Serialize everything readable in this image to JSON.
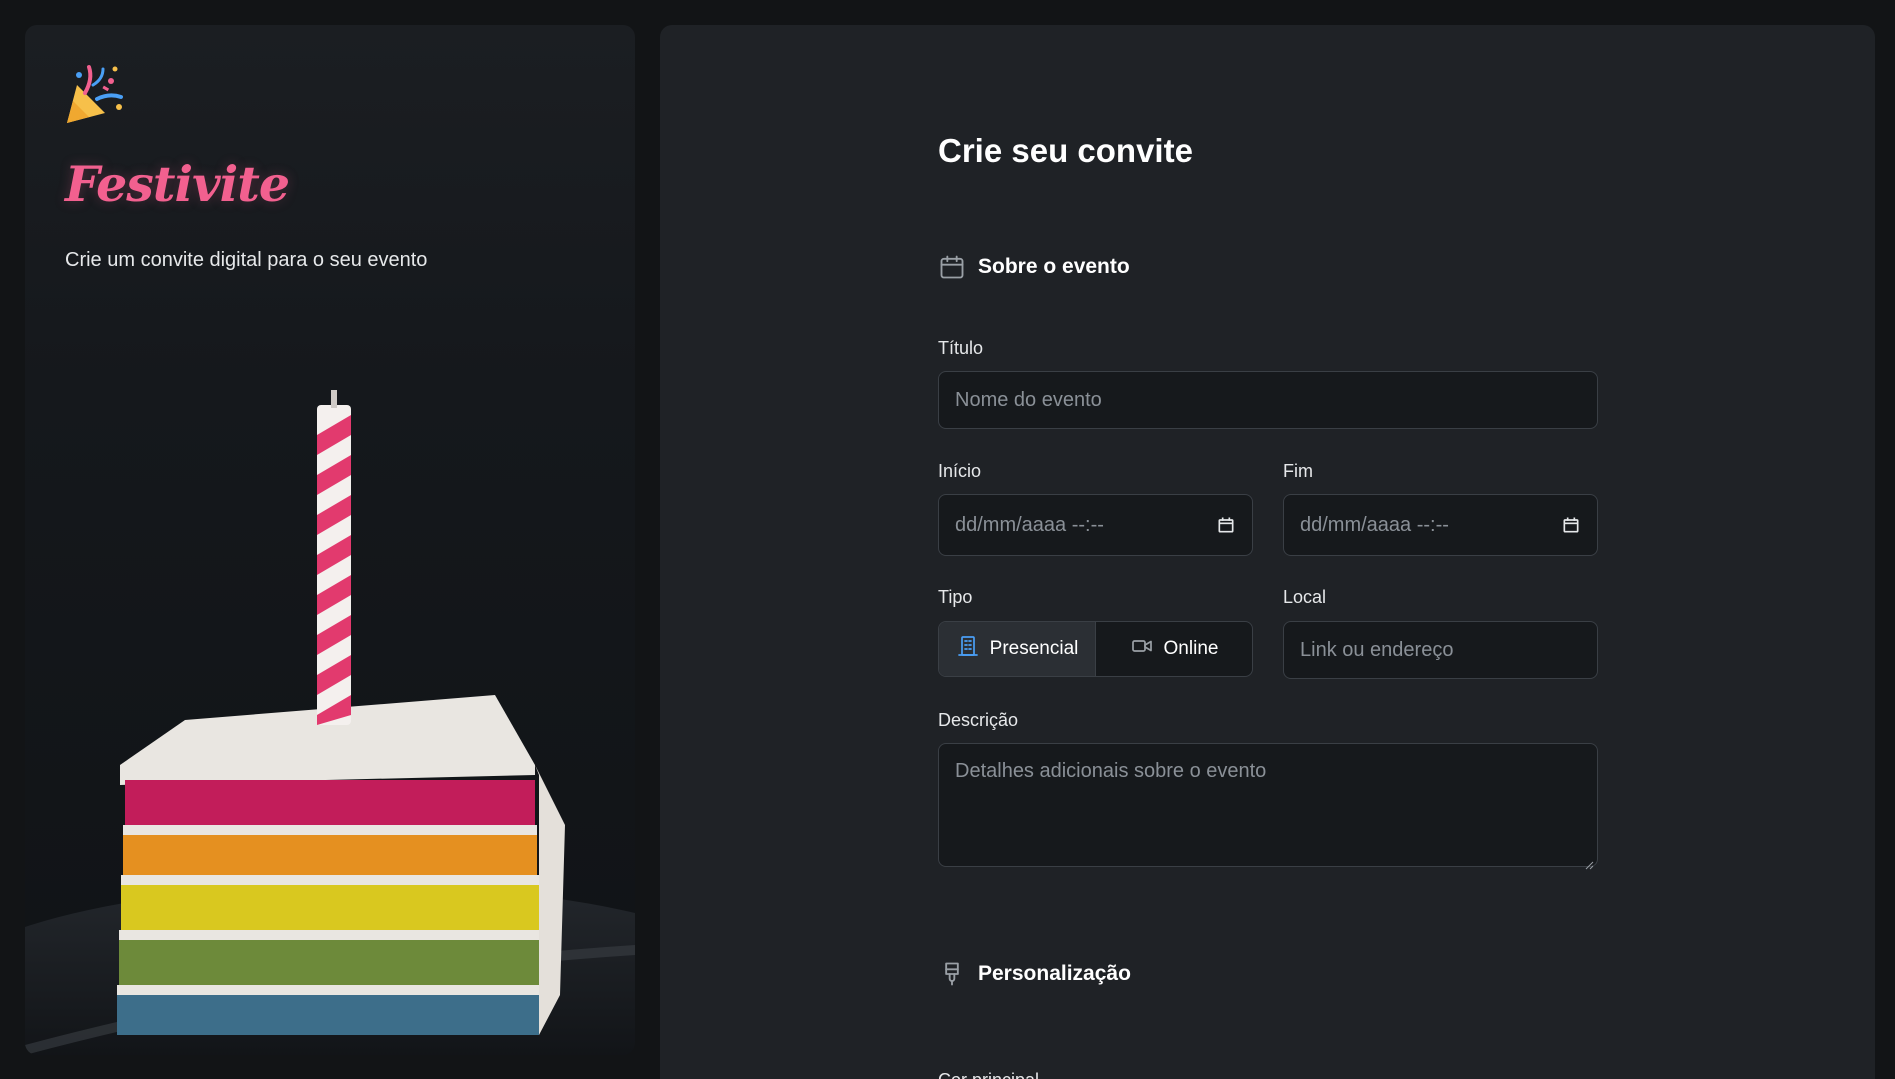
{
  "brand": {
    "name": "Festivite",
    "tagline": "Crie um convite digital para o seu evento",
    "icon": "party-popper-icon"
  },
  "form": {
    "title": "Crie seu convite",
    "section_event": {
      "title": "Sobre o evento",
      "icon": "calendar-icon"
    },
    "titulo": {
      "label": "Título",
      "placeholder": "Nome do evento"
    },
    "inicio": {
      "label": "Início",
      "placeholder": "dd/mm/aaaa --:--"
    },
    "fim": {
      "label": "Fim",
      "placeholder": "dd/mm/aaaa --:--"
    },
    "tipo": {
      "label": "Tipo",
      "options": [
        {
          "label": "Presencial",
          "icon": "building-icon",
          "selected": true
        },
        {
          "label": "Online",
          "icon": "video-camera-icon",
          "selected": false
        }
      ]
    },
    "local": {
      "label": "Local",
      "placeholder": "Link ou endereço"
    },
    "descricao": {
      "label": "Descrição",
      "placeholder": "Detalhes adicionais sobre o evento"
    },
    "section_custom": {
      "title": "Personalização",
      "icon": "paintbrush-icon"
    },
    "cor_principal": {
      "label": "Cor principal"
    }
  },
  "colors": {
    "brand_pink": "#f2608f",
    "accent_blue": "#4a9ff5",
    "panel_bg": "#1f2226",
    "input_bg": "#16191c"
  }
}
